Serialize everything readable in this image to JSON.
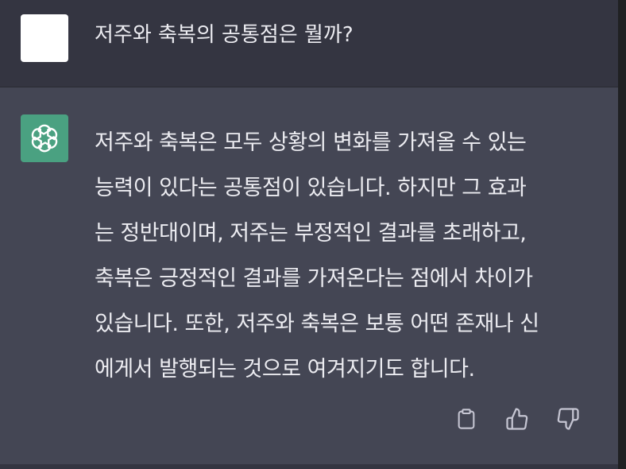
{
  "user": {
    "message": "저주와 축복의 공통점은 뭘까?"
  },
  "assistant": {
    "lines": [
      "저주와 축복은 모두 상황의 변화를 가져올 수 있는",
      "능력이 있다는 공통점이 있습니다. 하지만 그 효과",
      "는 정반대이며, 저주는 부정적인 결과를 초래하고,",
      "축복은 긍정적인 결과를 가져온다는 점에서 차이가",
      "있습니다. 또한, 저주와 축복은 보통 어떤 존재나 신",
      "에게서 발행되는 것으로 여겨지기도 합니다."
    ],
    "icons": {
      "avatar": "openai-logo-icon",
      "copy": "clipboard-icon",
      "like": "thumbs-up-icon",
      "dislike": "thumbs-down-icon"
    }
  },
  "colors": {
    "user_bg": "#343541",
    "assistant_bg": "#444654",
    "bot_avatar": "#4aa181",
    "text": "#ececf1"
  }
}
